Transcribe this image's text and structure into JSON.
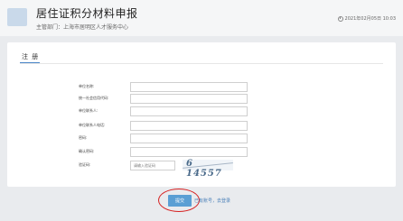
{
  "header": {
    "title": "居住证积分材料申报",
    "subtitle": "主管部门：上海市居明区人才服务中心",
    "datetime": "2021年02月05日 10:03"
  },
  "card": {
    "title": "注 册"
  },
  "form": {
    "fields": [
      {
        "label": "单位名称:",
        "value": ""
      },
      {
        "label": "统一社会信用代码:",
        "value": ""
      },
      {
        "label": "单位联系人:",
        "value": ""
      },
      {
        "label": "单位联系人电话:",
        "value": ""
      },
      {
        "label": "密码:",
        "value": ""
      },
      {
        "label": "确认密码:",
        "value": ""
      }
    ],
    "captcha_label": "验证码:",
    "captcha_placeholder": "请输入验证码",
    "captcha_text": "6 14557"
  },
  "actions": {
    "submit_label": "提交",
    "register_link": "已有账号，去登录"
  },
  "colors": {
    "accent": "#5a9fd4",
    "annotation": "#d62020"
  }
}
